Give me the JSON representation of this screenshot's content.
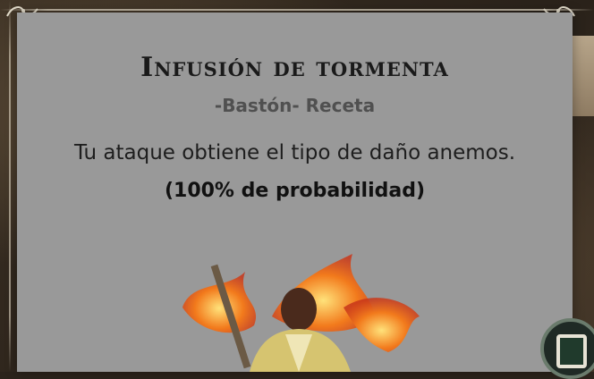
{
  "card": {
    "title": "Infusión de tormenta",
    "subtitle": "-Bastón- Receta",
    "description": "Tu ataque obtiene el tipo de daño anemos.",
    "chance": "(100% de probabilidad)"
  },
  "colors": {
    "card_bg": "#999999",
    "title": "#1a1a1a",
    "subtitle": "#505050",
    "fire": "#f07a1a"
  },
  "icons": {
    "flourish": "ornament-flourish-icon",
    "badge": "deck-card-icon"
  }
}
